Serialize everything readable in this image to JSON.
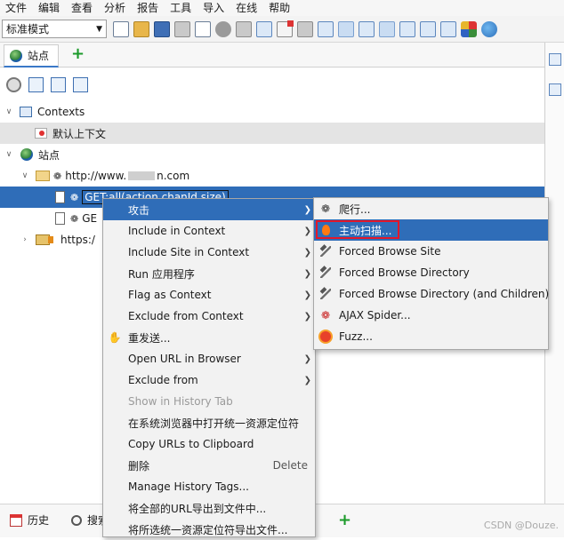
{
  "menubar": {
    "items": [
      "文件",
      "编辑",
      "查看",
      "分析",
      "报告",
      "工具",
      "导入",
      "在线",
      "帮助"
    ]
  },
  "toolbar": {
    "mode": "标准模式",
    "icons": [
      "new-session-icon",
      "open-session-icon",
      "save-session-icon",
      "snapshot-icon",
      "session-properties-icon",
      "options-gear-icon",
      "export-icon",
      "break-icon",
      "delete-break-icon",
      "layout-icon",
      "layout-tabs-icon",
      "layout-full-icon",
      "show-all-tabs-icon",
      "show-tab-names-icon",
      "pin-icon",
      "fullscreen-icon",
      "add-ons-icon",
      "marketplace-globe-icon"
    ]
  },
  "left_tabs": {
    "sites_tab": "站点"
  },
  "tree": {
    "contexts": "Contexts",
    "default_context": "默认上下文",
    "sites": "站点",
    "host": "http://www.",
    "host_suffix": "n.com",
    "selected_node": "GET:all(action,chanId,size)",
    "second_node": "GE",
    "https_node": "https:/"
  },
  "context_menu": {
    "items": [
      {
        "label": "攻击",
        "submenu": true
      },
      {
        "label": "Include in Context",
        "submenu": true
      },
      {
        "label": "Include Site in Context",
        "submenu": true
      },
      {
        "label": "Run 应用程序",
        "submenu": true
      },
      {
        "label": "Flag as Context",
        "submenu": true
      },
      {
        "label": "Exclude from Context",
        "submenu": true
      },
      {
        "label": "重发送..."
      },
      {
        "label": "Open URL in Browser",
        "submenu": true
      },
      {
        "label": "Exclude from",
        "submenu": true
      },
      {
        "label": "Show in History Tab",
        "disabled": true
      },
      {
        "label": "在系统浏览器中打开统一资源定位符"
      },
      {
        "label": "Copy URLs to Clipboard"
      },
      {
        "label": "删除",
        "shortcut": "Delete"
      },
      {
        "label": "Manage History Tags..."
      },
      {
        "label": "将全部的URL导出到文件中..."
      },
      {
        "label": "将所选统一资源定位符导出文件..."
      }
    ]
  },
  "attack_submenu": {
    "items": [
      {
        "label": "爬行...",
        "icon": "spider-icon"
      },
      {
        "label": "主动扫描...",
        "icon": "flame-icon"
      },
      {
        "label": "Forced Browse Site",
        "icon": "hammer-icon"
      },
      {
        "label": "Forced Browse Directory",
        "icon": "hammer-icon"
      },
      {
        "label": "Forced Browse Directory (and Children)",
        "icon": "hammer-icon"
      },
      {
        "label": "AJAX Spider...",
        "icon": "red-spider-icon"
      },
      {
        "label": "Fuzz...",
        "icon": "fuzz-icon"
      }
    ]
  },
  "bottom_tabs": {
    "history": "历史",
    "search": "搜索"
  },
  "watermark": "CSDN @Douze.",
  "colors": {
    "selection": "#2f6db8",
    "highlight_box": "#e2182a",
    "add_green": "#1b9a2a"
  }
}
